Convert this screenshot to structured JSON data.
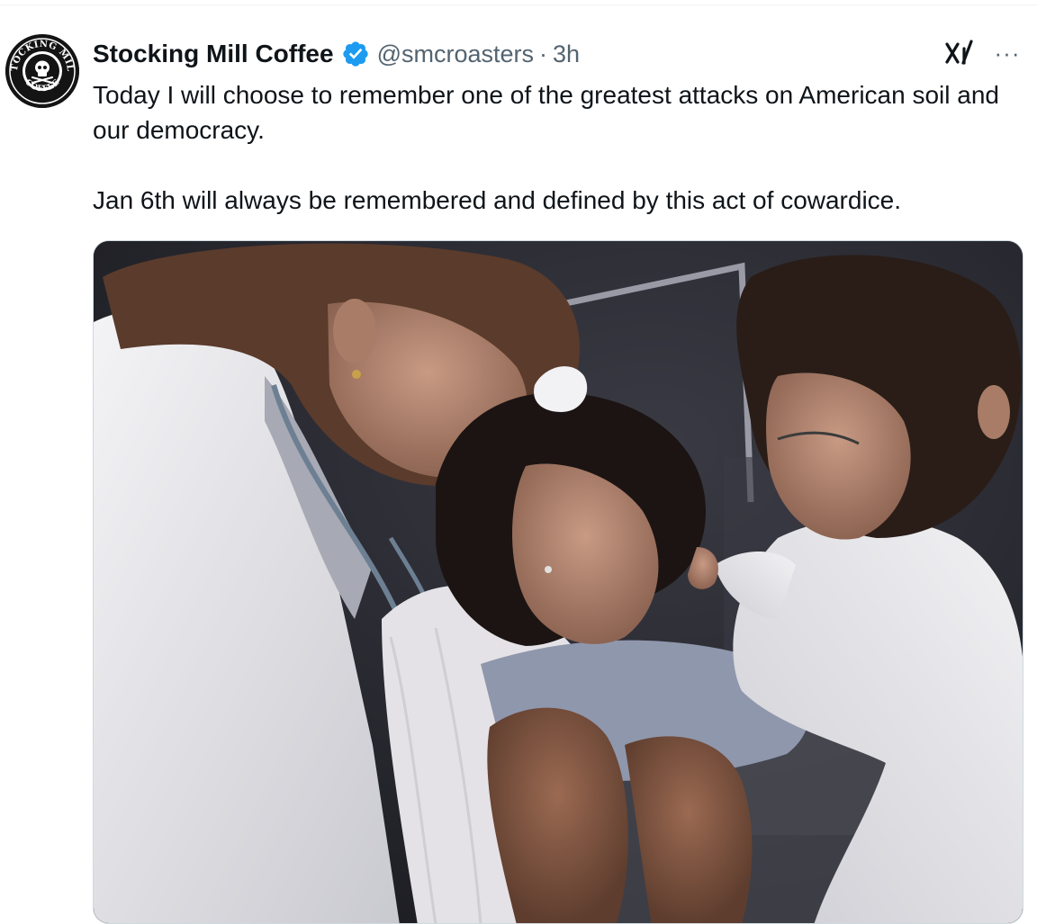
{
  "tweet": {
    "author": {
      "display_name": "Stocking Mill Coffee",
      "handle": "@smcroasters",
      "verified": true,
      "avatar_text_top": "STOCKING MILL",
      "avatar_text_bottom": "COFFEE",
      "avatar_icon": "skull-crossbones-logo"
    },
    "separator": "·",
    "timestamp": "3h",
    "text_paragraphs": [
      "Today I will choose to remember one of the greatest attacks on American soil and our democracy.",
      "Jan 6th will always be remembered and defined by this act of cowardice."
    ],
    "media": {
      "type": "photo",
      "icon": "photo-image"
    },
    "actions": {
      "grok_icon": "grok-icon",
      "more_icon": "more-options-icon",
      "more_glyph": "···"
    }
  },
  "colors": {
    "text_primary": "#0f1419",
    "text_secondary": "#536471",
    "verified_blue": "#1d9bf0",
    "border": "#cfd9de"
  }
}
